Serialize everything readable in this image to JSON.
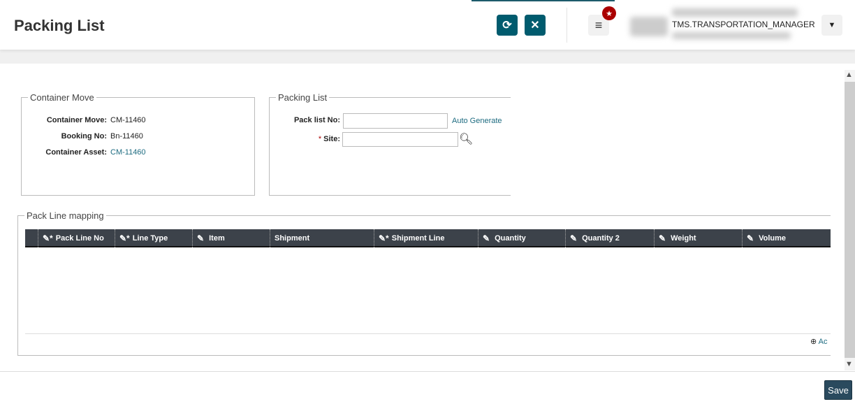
{
  "header": {
    "title": "Packing List",
    "refresh_icon": "refresh-icon",
    "close_icon": "close-icon",
    "menu_icon": "hamburger-icon",
    "badge_icon": "star-icon",
    "username": "TMS.TRANSPORTATION_MANAGER"
  },
  "container_move": {
    "legend": "Container Move",
    "fields": [
      {
        "label": "Container Move:",
        "value": "CM-11460"
      },
      {
        "label": "Booking No:",
        "value": "Bn-11460"
      },
      {
        "label": "Container Asset:",
        "value": "CM-11460"
      }
    ]
  },
  "packing_list": {
    "legend": "Packing List",
    "pack_list_label": "Pack list No:",
    "pack_list_value": "",
    "auto_generate": "Auto Generate",
    "site_required": "*",
    "site_label": "Site:",
    "site_value": ""
  },
  "pack_line": {
    "legend": "Pack Line mapping",
    "columns": [
      "Pack Line No",
      "Line Type",
      "Item",
      "Shipment",
      "Shipment Line",
      "Quantity",
      "Quantity 2",
      "Weight",
      "Volume"
    ],
    "add_label": "Ac"
  },
  "footer": {
    "save": "Save"
  },
  "colors": {
    "accent": "#005b6e",
    "save": "#2a4a5e",
    "badge": "#aa0000"
  }
}
